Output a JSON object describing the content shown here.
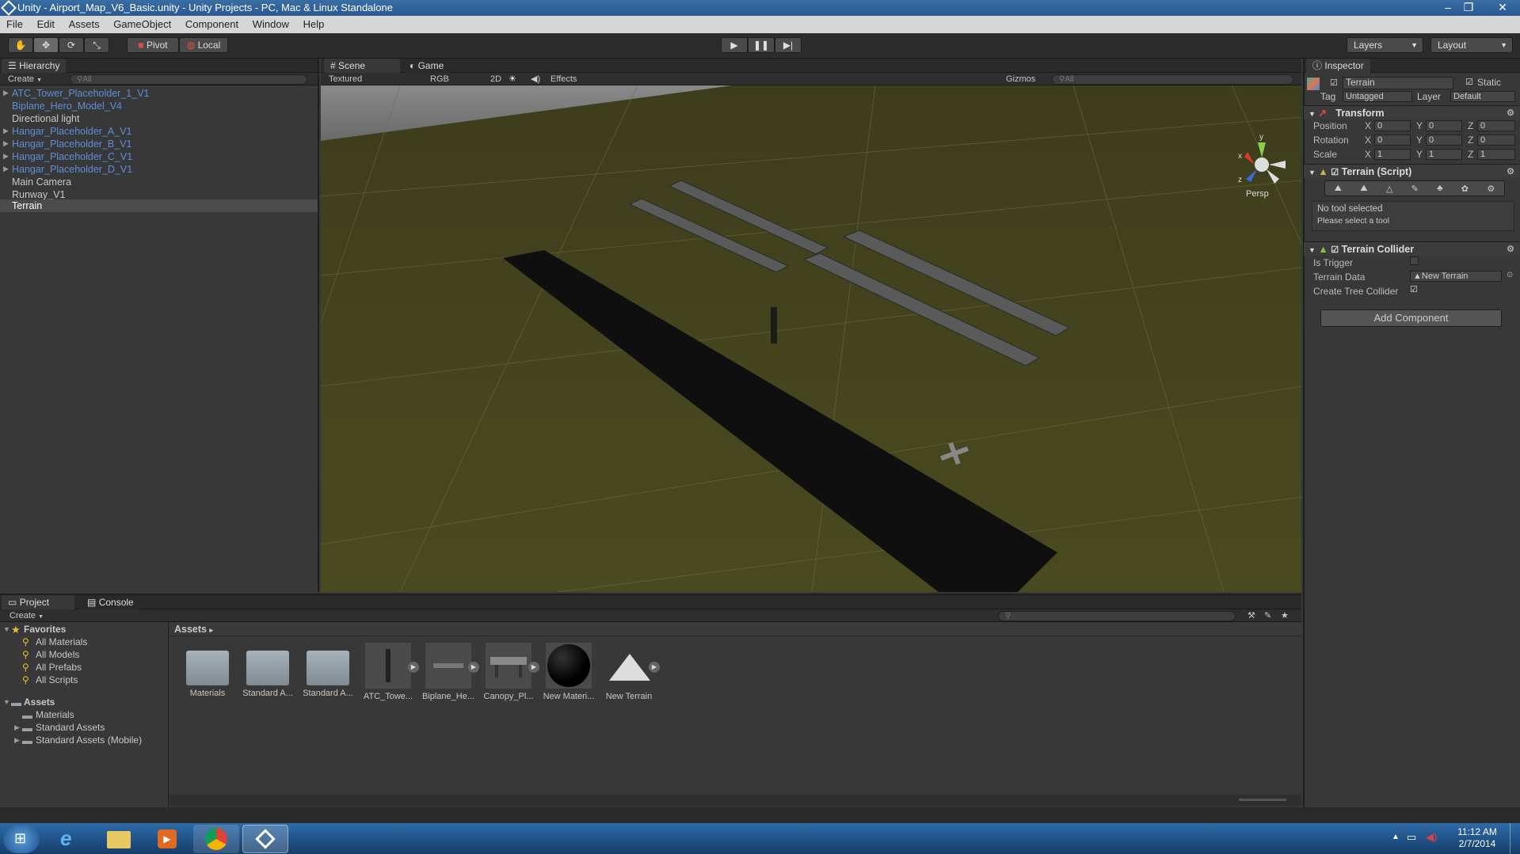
{
  "window": {
    "title": "Unity - Airport_Map_V6_Basic.unity - Unity Projects - PC, Mac & Linux Standalone",
    "controls": [
      "–",
      "❐",
      "✕"
    ]
  },
  "menu": [
    "File",
    "Edit",
    "Assets",
    "GameObject",
    "Component",
    "Window",
    "Help"
  ],
  "toolbar": {
    "pivot": "Pivot",
    "local": "Local",
    "layers": "Layers",
    "layout": "Layout"
  },
  "hierarchy": {
    "tab": "Hierarchy",
    "create": "Create",
    "search_placeholder": "All",
    "items": [
      {
        "label": "ATC_Tower_Placeholder_1_V1",
        "prefab": true,
        "expandable": false
      },
      {
        "label": "Biplane_Hero_Model_V4",
        "prefab": true,
        "expandable": true
      },
      {
        "label": "Directional light",
        "prefab": false,
        "expandable": false
      },
      {
        "label": "Hangar_Placeholder_A_V1",
        "prefab": true,
        "expandable": true
      },
      {
        "label": "Hangar_Placeholder_B_V1",
        "prefab": true,
        "expandable": true
      },
      {
        "label": "Hangar_Placeholder_C_V1",
        "prefab": true,
        "expandable": true
      },
      {
        "label": "Hangar_Placeholder_D_V1",
        "prefab": true,
        "expandable": true
      },
      {
        "label": "Main Camera",
        "prefab": false,
        "expandable": false
      },
      {
        "label": "Runway_V1",
        "prefab": false,
        "expandable": false
      },
      {
        "label": "Terrain",
        "prefab": false,
        "expandable": false,
        "selected": true
      }
    ]
  },
  "scene": {
    "tab_scene": "Scene",
    "tab_game": "Game",
    "render_mode": "Textured",
    "color_mode": "RGB",
    "btn_2d": "2D",
    "effects": "Effects",
    "gizmos": "Gizmos",
    "search_placeholder": "All",
    "persp": "Persp",
    "axes": {
      "x": "x",
      "y": "y",
      "z": "z"
    }
  },
  "inspector": {
    "tab": "Inspector",
    "object_name": "Terrain",
    "static_label": "Static",
    "tag_label": "Tag",
    "tag_value": "Untagged",
    "layer_label": "Layer",
    "layer_value": "Default",
    "transform": {
      "title": "Transform",
      "position": {
        "label": "Position",
        "x": "0",
        "y": "0",
        "z": "0"
      },
      "rotation": {
        "label": "Rotation",
        "x": "0",
        "y": "0",
        "z": "0"
      },
      "scale": {
        "label": "Scale",
        "x": "1",
        "y": "1",
        "z": "1"
      }
    },
    "terrain_script": {
      "title": "Terrain (Script)",
      "status": "No tool selected",
      "hint": "Please select a tool"
    },
    "terrain_collider": {
      "title": "Terrain Collider",
      "is_trigger": "Is Trigger",
      "terrain_data": "Terrain Data",
      "terrain_data_value": "New Terrain",
      "create_tree_collider": "Create Tree Collider"
    },
    "add_component": "Add Component"
  },
  "project": {
    "tab_project": "Project",
    "tab_console": "Console",
    "create": "Create",
    "favorites_label": "Favorites",
    "favorites": [
      "All Materials",
      "All Models",
      "All Prefabs",
      "All Scripts"
    ],
    "assets_label": "Assets",
    "asset_folders": [
      "Materials",
      "Standard Assets",
      "Standard Assets (Mobile)"
    ],
    "breadcrumb": "Assets",
    "grid": [
      {
        "label": "Materials",
        "kind": "folder"
      },
      {
        "label": "Standard A...",
        "kind": "folder"
      },
      {
        "label": "Standard A...",
        "kind": "folder"
      },
      {
        "label": "ATC_Towe...",
        "kind": "prefab"
      },
      {
        "label": "Biplane_He...",
        "kind": "prefab"
      },
      {
        "label": "Canopy_Pl...",
        "kind": "prefab"
      },
      {
        "label": "New Materi...",
        "kind": "material"
      },
      {
        "label": "New Terrain",
        "kind": "terrain"
      }
    ]
  },
  "taskbar": {
    "time": "11:12 AM",
    "date": "2/7/2014"
  },
  "colors": {
    "accent_blue": "#5d8fd8",
    "terrain": "#4a4a1f",
    "sky": "#8f8f8f"
  }
}
